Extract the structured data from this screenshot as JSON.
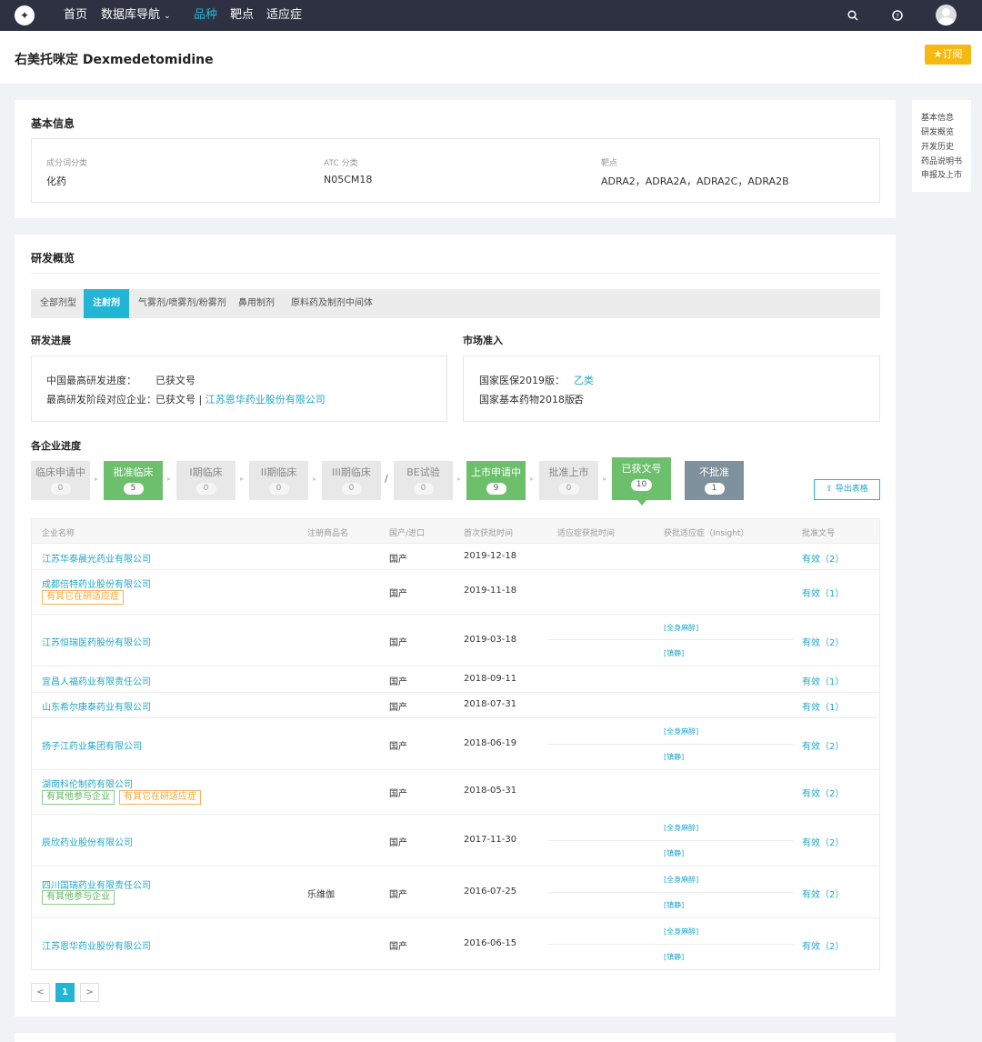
{
  "nav": {
    "logo": "",
    "home": "首页",
    "database_nav": "数据库导航",
    "varieties": "品种",
    "targets": "靶点",
    "indications": "适应症"
  },
  "title": "右美托咪定 Dexmedetomidine",
  "subscribe_label": "订阅",
  "basic_info": {
    "heading": "基本信息",
    "fields": [
      {
        "label": "成分词分类",
        "value": "化药"
      },
      {
        "label": "ATC 分类",
        "value": "N05CM18"
      },
      {
        "label": "靶点",
        "value": "ADRA2，ADRA2A，ADRA2C，ADRA2B"
      }
    ]
  },
  "overview": {
    "heading": "研发概览",
    "tabs": [
      "全部剂型",
      "注射剂",
      "气雾剂/喷雾剂/粉雾剂",
      "鼻用制剂",
      "原料药及制剂中间体"
    ],
    "active_tab": "注射剂",
    "progress": {
      "heading": "研发进展",
      "highest_label": "中国最高研发进度：",
      "highest_value": "已获文号",
      "company_label": "最高研发阶段对应企业：",
      "company_prefix": "已获文号 | ",
      "company_link": "江苏恩华药业股份有限公司"
    },
    "market": {
      "heading": "市场准入",
      "insurance_label": "国家医保2019版：",
      "insurance_value": "乙类",
      "essential_label": "国家基本药物2018版：",
      "essential_value": "否"
    }
  },
  "company_progress": {
    "heading": "各企业进度",
    "stages": [
      {
        "name": "临床申请中",
        "count": "0"
      },
      {
        "name": "批准临床",
        "count": "5"
      },
      {
        "name": "I期临床",
        "count": "0"
      },
      {
        "name": "II期临床",
        "count": "0"
      },
      {
        "name": "III期临床",
        "count": "0"
      },
      {
        "name": "BE试验",
        "count": "0"
      },
      {
        "name": "上市申请中",
        "count": "9"
      },
      {
        "name": "批准上市",
        "count": "0"
      },
      {
        "name": "已获文号",
        "count": "10"
      },
      {
        "name": "不批准",
        "count": "1"
      }
    ],
    "separator": "/",
    "export_label": "导出表格",
    "columns": [
      "企业名称",
      "注册商品名",
      "国产/进口",
      "首次获批时间",
      "适应症获批时间",
      "获批适应症（Insight）",
      "批准文号"
    ],
    "rows": [
      {
        "company": "江苏华泰晨光药业有限公司",
        "brand": "",
        "origin": "国产",
        "date": "2019-12-18",
        "tags": [],
        "indications": [],
        "approval": "有效（2）"
      },
      {
        "company": "成都倍特药业股份有限公司",
        "brand": "",
        "origin": "国产",
        "date": "2019-11-18",
        "tags": [
          "有其它在研适应症"
        ],
        "indications": [],
        "approval": "有效（1）"
      },
      {
        "company": "江苏恒瑞医药股份有限公司",
        "brand": "",
        "origin": "国产",
        "date": "2019-03-18",
        "tags": [],
        "indications": [
          "[全身麻醉]",
          "[镇静]"
        ],
        "approval": "有效（2）"
      },
      {
        "company": "宜昌人福药业有限责任公司",
        "brand": "",
        "origin": "国产",
        "date": "2018-09-11",
        "tags": [],
        "indications": [],
        "approval": "有效（1）"
      },
      {
        "company": "山东希尔康泰药业有限公司",
        "brand": "",
        "origin": "国产",
        "date": "2018-07-31",
        "tags": [],
        "indications": [],
        "approval": "有效（1）"
      },
      {
        "company": "扬子江药业集团有限公司",
        "brand": "",
        "origin": "国产",
        "date": "2018-06-19",
        "tags": [],
        "indications": [
          "[全身麻醉]",
          "[镇静]"
        ],
        "approval": "有效（2）"
      },
      {
        "company": "湖南科伦制药有限公司",
        "brand": "",
        "origin": "国产",
        "date": "2018-05-31",
        "tags": [
          "有其他参与企业",
          "有其它在研适应症"
        ],
        "indications": [],
        "approval": "有效（2）"
      },
      {
        "company": "辰欣药业股份有限公司",
        "brand": "",
        "origin": "国产",
        "date": "2017-11-30",
        "tags": [],
        "indications": [
          "[全身麻醉]",
          "[镇静]"
        ],
        "approval": "有效（2）"
      },
      {
        "company": "四川国瑞药业有限责任公司",
        "brand": "乐维伽",
        "origin": "国产",
        "date": "2016-07-25",
        "tags": [
          "有其他参与企业"
        ],
        "indications": [
          "[全身麻醉]",
          "[镇静]"
        ],
        "approval": "有效（2）"
      },
      {
        "company": "江苏恩华药业股份有限公司",
        "brand": "",
        "origin": "国产",
        "date": "2016-06-15",
        "tags": [],
        "indications": [
          "[全身麻醉]",
          "[镇静]"
        ],
        "approval": "有效（2）"
      }
    ],
    "pagination": {
      "prev": "<",
      "page": "1",
      "next": ">"
    }
  },
  "side_nav": [
    "基本信息",
    "研发概览",
    "开发历史",
    "药品说明书",
    "申报及上市"
  ],
  "icons": {
    "search": "search-icon",
    "help": "help-icon",
    "star": "star-icon",
    "export": "export-icon"
  },
  "colors": {
    "accent": "#22b5d6",
    "nav_bg": "#2d3142",
    "subscribe": "#f5b912",
    "stage_green": "#6cc06b",
    "stage_gray": "#7f919d",
    "tag_orange": "#f5a623",
    "tag_green": "#5fb15f"
  }
}
